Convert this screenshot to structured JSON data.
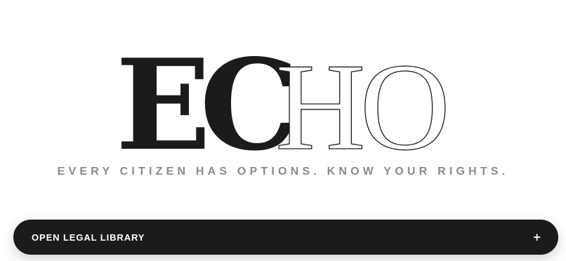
{
  "logo": {
    "text": "ECHO",
    "filled_part": "EC",
    "outlined_part": "HO",
    "fill_color": "#1b1b1b",
    "outline_color": "#1b1b1b"
  },
  "tagline": "EVERY CITIZEN HAS OPTIONS. KNOW YOUR RIGHTS.",
  "library_bar": {
    "label": "OPEN LEGAL LIBRARY",
    "icon": "plus-icon",
    "icon_glyph": "+",
    "background": "#1b1b1b"
  }
}
